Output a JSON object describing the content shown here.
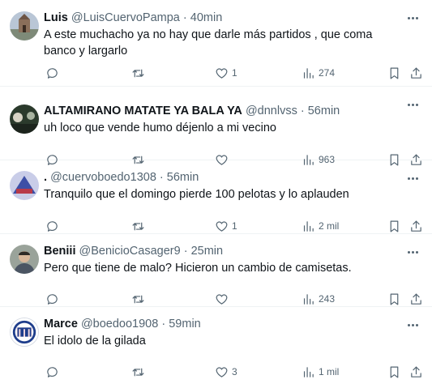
{
  "tweets": [
    {
      "name": "Luis",
      "handle": "@LuisCuervoPampa",
      "separator": "·",
      "time": "40min",
      "text": "A este muchacho ya no hay que darle más partidos , que coma banco y largarlo",
      "likes": "1",
      "views": "274",
      "avatar_color": "#6b7f96"
    },
    {
      "name": "ALTAMIRANO MATATE YA BALA YA",
      "handle": "@dnnlvss",
      "separator": "·",
      "time": "56min",
      "text": "uh loco que vende humo déjenlo a mi vecino",
      "likes": "",
      "views": "963",
      "avatar_color": "#3a4a3a"
    },
    {
      "name": ".",
      "handle": "@cuervoboedo1308",
      "separator": "·",
      "time": "56min",
      "text": "Tranquilo que el domingo pierde 100 pelotas y lo aplauden",
      "likes": "1",
      "views": "2 mil",
      "avatar_color": "#4a5aa8"
    },
    {
      "name": "Beniii",
      "handle": "@BenicioCasager9",
      "separator": "·",
      "time": "25min",
      "text": "Pero que tiene de malo? Hicieron un cambio de camisetas.",
      "likes": "",
      "views": "243",
      "avatar_color": "#8a8f86"
    },
    {
      "name": "Marce",
      "handle": "@boedoo1908",
      "separator": "·",
      "time": "59min",
      "text": "El idolo de la gilada",
      "likes": "3",
      "views": "1 mil",
      "avatar_color": "#1f3e8c"
    }
  ]
}
